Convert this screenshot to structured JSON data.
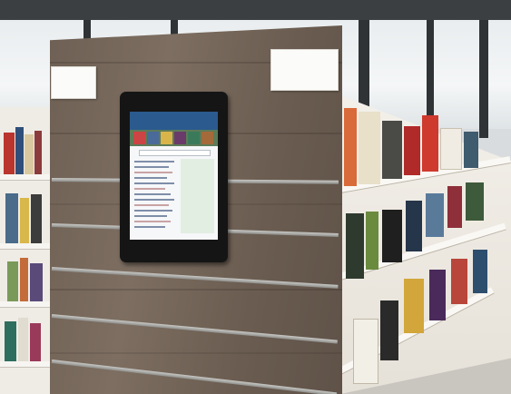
{
  "scene": {
    "description_colors": {
      "panel_wood": "#6e6054",
      "slat_metal": "#a9a9a6",
      "tablet_frame": "#151515",
      "screen_header": "#2b5a8e",
      "shelf_white": "#f3f0ea",
      "sign_paper": "#fbfbf9"
    }
  },
  "sign_left": {
    "text": ""
  },
  "sign_right": {
    "line1": "",
    "line2": ""
  },
  "kiosk": {
    "screen_title": ""
  }
}
